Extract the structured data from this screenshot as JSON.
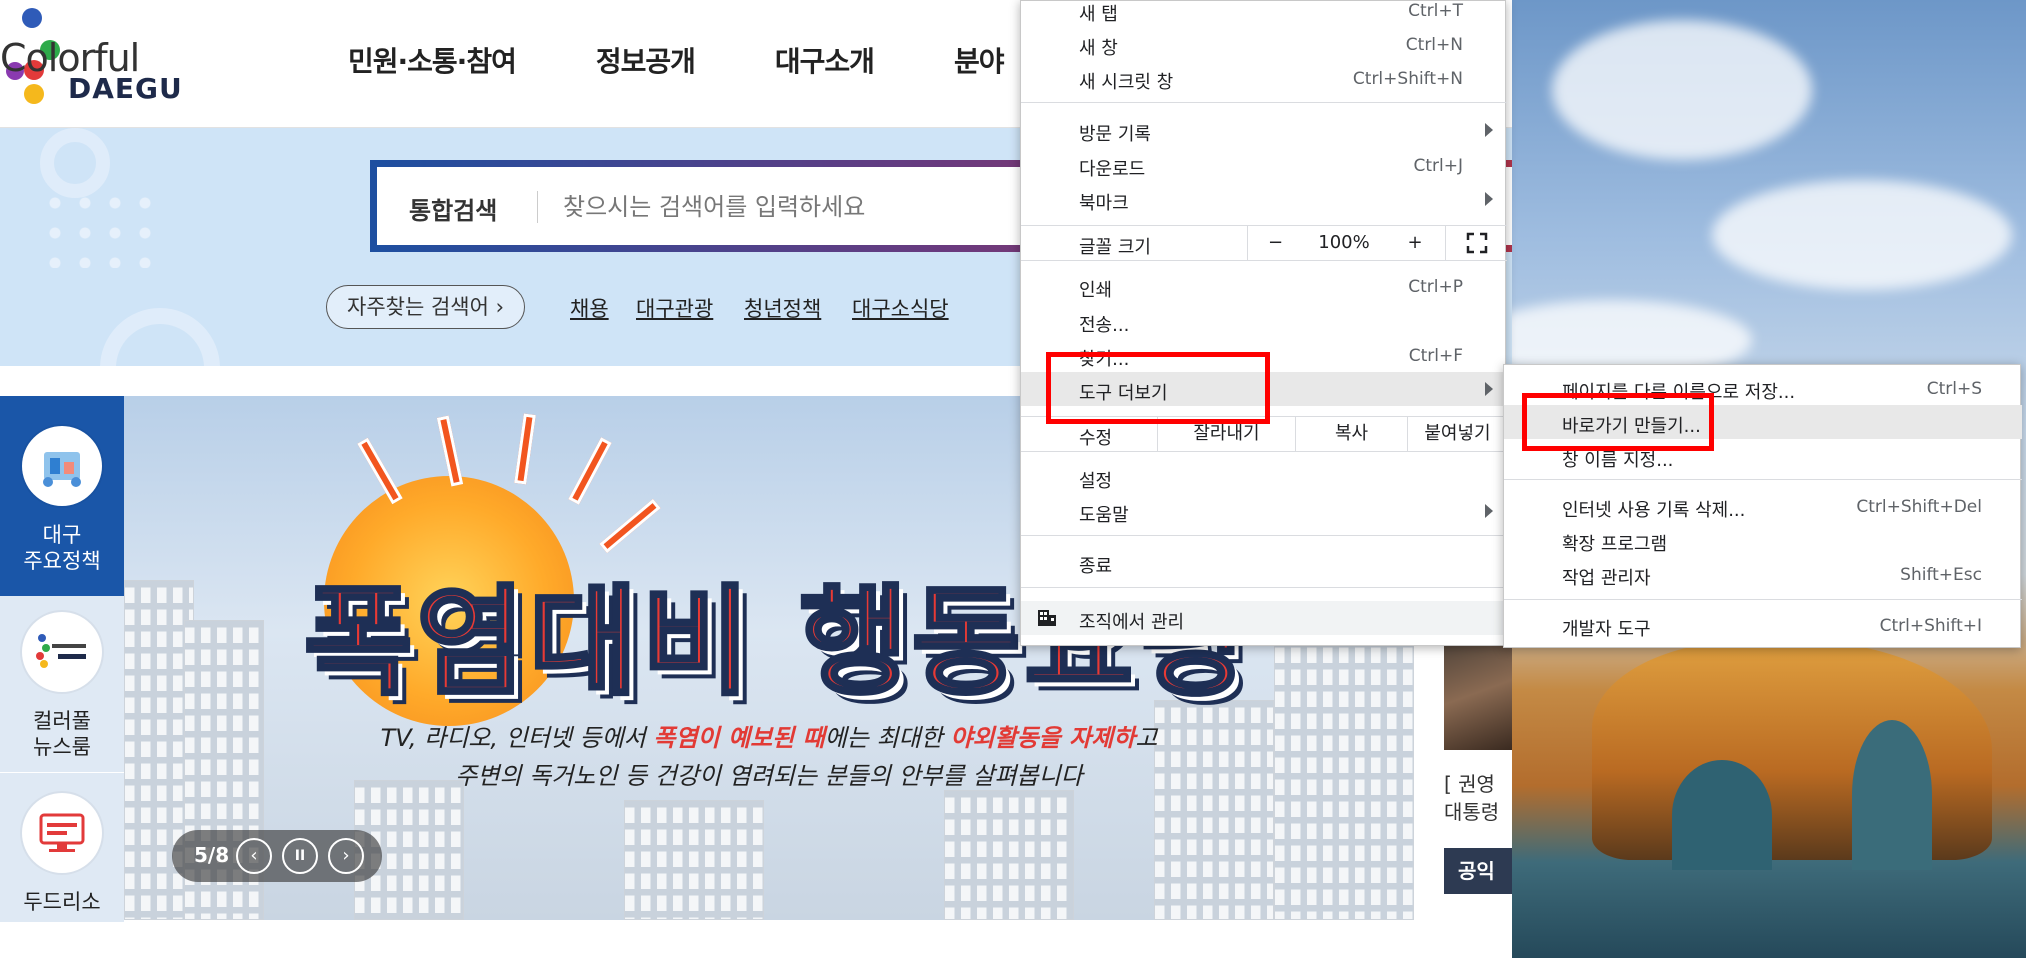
{
  "site": {
    "logo": {
      "colorful": "Colorful",
      "daegu": "DAEGU"
    },
    "gnb": [
      "민원·소통·참여",
      "정보공개",
      "대구소개",
      "분야"
    ],
    "search": {
      "label": "통합검색",
      "placeholder": "찾으시는 검색어를 입력하세요"
    },
    "keywords": {
      "pill": "자주찾는 검색어 ›",
      "links": [
        "채용",
        "대구관광",
        "청년정책",
        "대구소식당"
      ]
    },
    "side_nav": [
      {
        "label_1": "대구",
        "label_2": "주요정책",
        "icon": "policy-icon",
        "active": true
      },
      {
        "label_1": "컬러풀",
        "label_2": "뉴스룸",
        "icon": "colorful-daegu-logo-icon",
        "active": false
      },
      {
        "label_1": "두드리소",
        "label_2": "",
        "icon": "dudeuriso-icon",
        "active": false
      }
    ],
    "banner": {
      "title": "폭염대비 행동요령",
      "line1_a": "TV, 라디오, 인터넷 등에서 ",
      "line1_hl1": "폭염이 예보된 때",
      "line1_b": "에는 최대한 ",
      "line1_hl2": "야외활동을 자제하",
      "line1_c": "고",
      "line2": "주변의 독거노인 등 건강이 염려되는 분들의 안부를 살펴봅니다",
      "pager": {
        "count": "5/8",
        "prev": "‹",
        "pause": "II",
        "next": "›"
      }
    },
    "news": {
      "text_1": "[ 권영",
      "text_2": "대통령",
      "button": "공익"
    }
  },
  "menu": {
    "items": {
      "new_tab": {
        "label": "새 탭",
        "shortcut": "Ctrl+T"
      },
      "new_window": {
        "label": "새 창",
        "shortcut": "Ctrl+N"
      },
      "incognito": {
        "label": "새 시크릿 창",
        "shortcut": "Ctrl+Shift+N"
      },
      "history": {
        "label": "방문 기록"
      },
      "downloads": {
        "label": "다운로드",
        "shortcut": "Ctrl+J"
      },
      "bookmarks": {
        "label": "북마크"
      },
      "zoom": {
        "label": "글꼴 크기",
        "minus": "−",
        "value": "100%",
        "plus": "+"
      },
      "print": {
        "label": "인쇄",
        "shortcut": "Ctrl+P"
      },
      "cast": {
        "label": "전송..."
      },
      "find": {
        "label": "찾기...",
        "shortcut": "Ctrl+F"
      },
      "more_tools": {
        "label": "도구 더보기"
      },
      "edit": {
        "label": "수정",
        "cut": "잘라내기",
        "copy": "복사",
        "paste": "붙여넣기"
      },
      "settings": {
        "label": "설정"
      },
      "help": {
        "label": "도움말"
      },
      "exit": {
        "label": "종료"
      },
      "managed": {
        "label": "조직에서 관리"
      }
    },
    "submenu": {
      "save_page": {
        "label": "페이지를 다른 이름으로 저장...",
        "shortcut": "Ctrl+S"
      },
      "create_shortcut": {
        "label": "바로가기 만들기..."
      },
      "name_window": {
        "label": "창 이름 지정..."
      },
      "clear_data": {
        "label": "인터넷 사용 기록 삭제...",
        "shortcut": "Ctrl+Shift+Del"
      },
      "extensions": {
        "label": "확장 프로그램"
      },
      "task_manager": {
        "label": "작업 관리자",
        "shortcut": "Shift+Esc"
      },
      "devtools": {
        "label": "개발자 도구",
        "shortcut": "Ctrl+Shift+I"
      }
    }
  },
  "colors": {
    "highlight_box": "#ff0000",
    "side_active": "#1a56a8",
    "side_inactive": "#dfe9f4",
    "search_border": "#1e4fa0"
  }
}
